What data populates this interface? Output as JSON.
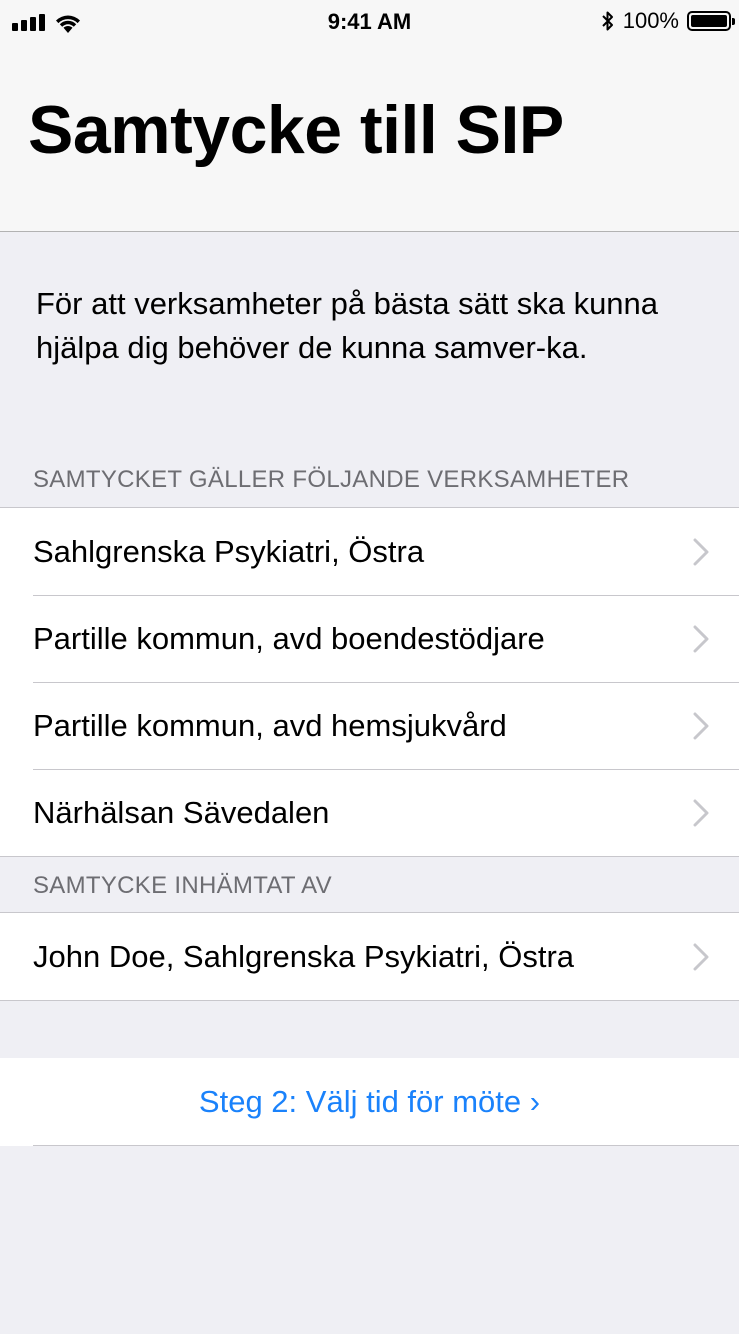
{
  "status_bar": {
    "time": "9:41 AM",
    "battery_percent": "100%",
    "battery_level": 1.0
  },
  "header": {
    "title": "Samtycke till SIP"
  },
  "intro": {
    "text": "För att verksamheter på bästa sätt ska kunna hjälpa dig behöver de kunna samver-ka."
  },
  "sections": {
    "organizations": {
      "header": "SAMTYCKET GÄLLER FÖLJANDE VERKSAMHETER",
      "items": [
        {
          "label": "Sahlgrenska Psykiatri, Östra"
        },
        {
          "label": "Partille kommun, avd boendestödjare"
        },
        {
          "label": "Partille kommun, avd hemsjukvård"
        },
        {
          "label": "Närhälsan Sävedalen"
        }
      ]
    },
    "collected_by": {
      "header": "SAMTYCKE INHÄMTAT AV",
      "items": [
        {
          "label": "John Doe, Sahlgrenska Psykiatri, Östra"
        }
      ]
    }
  },
  "action": {
    "label": "Steg 2: Välj tid för möte ›"
  },
  "colors": {
    "accent": "#1a82fb",
    "background": "#efeff4",
    "section_header_text": "#6d6d72",
    "separator": "#c8c7cc",
    "chevron": "#c7c7cc"
  }
}
